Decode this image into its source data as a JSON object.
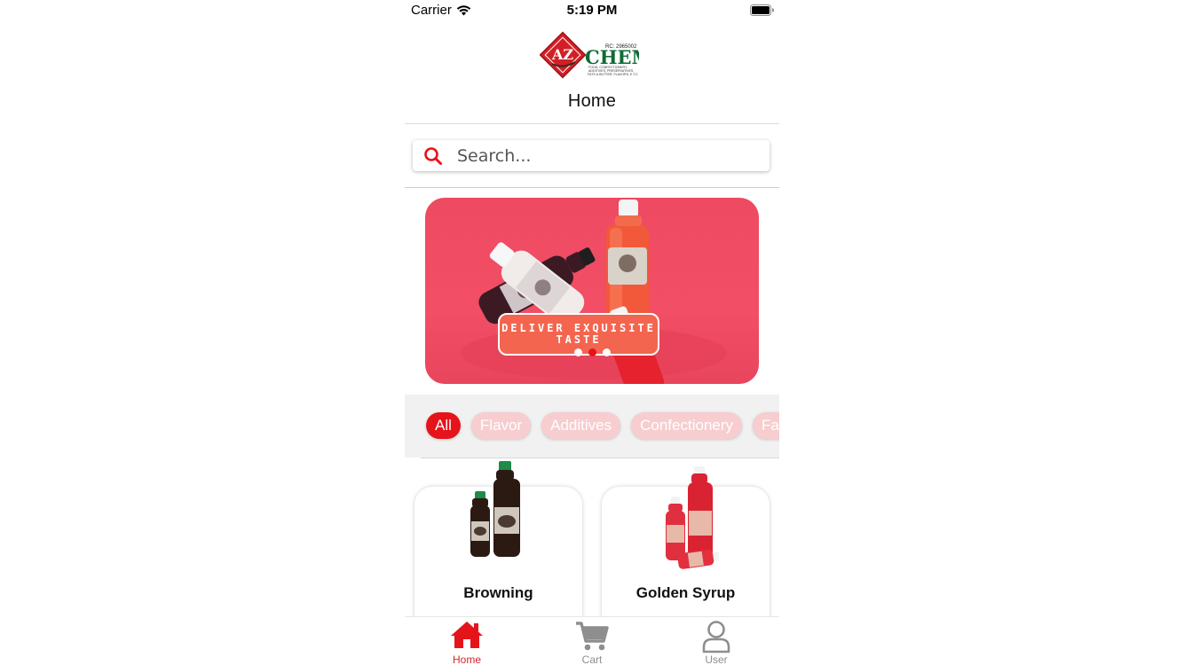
{
  "status_bar": {
    "carrier": "Carrier",
    "time": "5:19 PM"
  },
  "header": {
    "logo": {
      "mark": "AZ",
      "brand": "CHEM",
      "reg": "RC: 2965002",
      "tagline_1": "FOOD, CONFECTIONERY,",
      "tagline_2": "ADDITIVES, PRESERVATIVES,",
      "tagline_3": "FATS & BUTTER, FLAVORS, E.T.C"
    },
    "title": "Home"
  },
  "search": {
    "placeholder": "Search...",
    "value": "",
    "icon": "search-icon"
  },
  "banner": {
    "caption_line1": "DELIVER EXQUISITE",
    "caption_line2": "TASTE",
    "slides": 3,
    "active_slide": 2
  },
  "categories": {
    "items": [
      "All",
      "Flavor",
      "Additives",
      "Confectionery",
      "Fats"
    ],
    "selected": "All"
  },
  "products": [
    {
      "name": "Browning"
    },
    {
      "name": "Golden Syrup"
    }
  ],
  "tabbar": {
    "items": [
      {
        "label": "Home",
        "icon": "home-icon"
      },
      {
        "label": "Cart",
        "icon": "cart-icon"
      },
      {
        "label": "User",
        "icon": "user-icon"
      }
    ],
    "active": "Home"
  },
  "colors": {
    "accent": "#e5141b",
    "chip_inactive": "#f7cdd0",
    "banner_bg": "#f24e66"
  }
}
